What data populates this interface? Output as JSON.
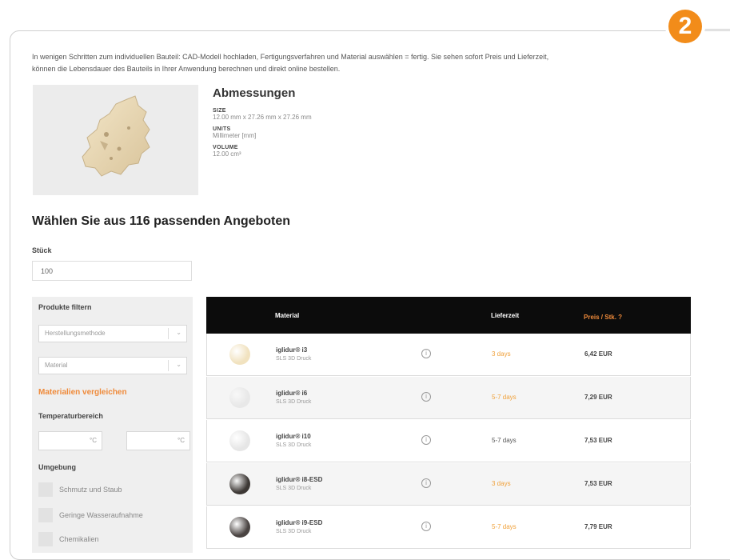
{
  "badge": "2",
  "intro": {
    "line1": "In wenigen Schritten zum individuellen Bauteil: CAD-Modell hochladen, Fertigungsverfahren und Material auswählen = fertig. Sie sehen sofort Preis und Lieferzeit,",
    "line2": "können die Lebensdauer des Bauteils in Ihrer Anwendung berechnen und direkt online bestellen."
  },
  "dimensions": {
    "title": "Abmessungen",
    "size_label": "SIZE",
    "size_value": "12.00 mm x 27.26 mm x 27.26 mm",
    "units_label": "UNITS",
    "units_value": "Millimeter [mm]",
    "volume_label": "VOLUME",
    "volume_value": "12.00 cm³"
  },
  "offers_title": "Wählen Sie aus 116 passenden Angeboten",
  "quantity": {
    "label": "Stück",
    "value": "100"
  },
  "filters": {
    "title": "Produkte filtern",
    "method_placeholder": "Herstellungsmethode",
    "material_placeholder": "Material",
    "compare_link": "Materialien vergleichen",
    "temp_title": "Temperaturbereich",
    "temp_unit_min": "°C",
    "temp_unit_max": "°C",
    "env_title": "Umgebung",
    "env_options": [
      "Schmutz und Staub",
      "Geringe Wasseraufnahme",
      "Chemikalien"
    ]
  },
  "table": {
    "headers": {
      "material": "Material",
      "lead": "Lieferzeit",
      "price": "Preis / Stk. ?"
    },
    "rows": [
      {
        "name": "iglidur® i3",
        "process": "SLS 3D Druck",
        "lead": "3 days",
        "lead_color": "orange",
        "price": "6,42 EUR",
        "swatch": "#f1e2bf"
      },
      {
        "name": "iglidur® i6",
        "process": "SLS 3D Druck",
        "lead": "5-7 days",
        "lead_color": "orange",
        "price": "7,29 EUR",
        "swatch": "#e8e8e8"
      },
      {
        "name": "iglidur® i10",
        "process": "SLS 3D Druck",
        "lead": "5-7 days",
        "lead_color": "dark",
        "price": "7,53 EUR",
        "swatch": "#e6e6e6"
      },
      {
        "name": "iglidur® i8-ESD",
        "process": "SLS 3D Druck",
        "lead": "3 days",
        "lead_color": "orange",
        "price": "7,53 EUR",
        "swatch": "#3d3835"
      },
      {
        "name": "iglidur® i9-ESD",
        "process": "SLS 3D Druck",
        "lead": "5-7 days",
        "lead_color": "orange",
        "price": "7,79 EUR",
        "swatch": "#4a4442"
      }
    ]
  }
}
